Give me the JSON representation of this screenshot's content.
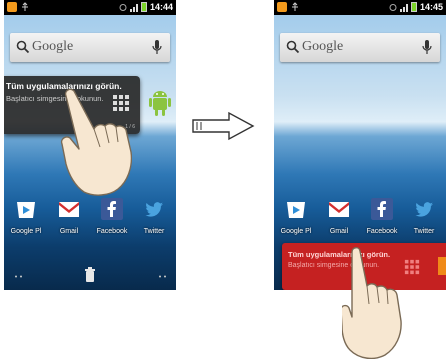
{
  "status_bar": {
    "time_left": "14:44",
    "time_right": "14:45"
  },
  "search": {
    "label": "Google"
  },
  "tooltip": {
    "title": "Tüm uygulamalarınızı görün.",
    "subtitle_left": "Başlatıcı simgesine dokunun.",
    "subtitle_right": "Başlatıcı simgesine dokunun.",
    "page_indicator": "1 / 6"
  },
  "apps": [
    {
      "label": "Google Pl",
      "icon": "play-store-icon"
    },
    {
      "label": "Gmail",
      "icon": "gmail-icon"
    },
    {
      "label": "Facebook",
      "icon": "facebook-icon"
    },
    {
      "label": "Twitter",
      "icon": "twitter-icon"
    }
  ],
  "colors": {
    "tooltip_red": "#c52121",
    "tooltip_dark": "#282828",
    "battery": "#7dd52b",
    "notification": "#f39a1c"
  }
}
